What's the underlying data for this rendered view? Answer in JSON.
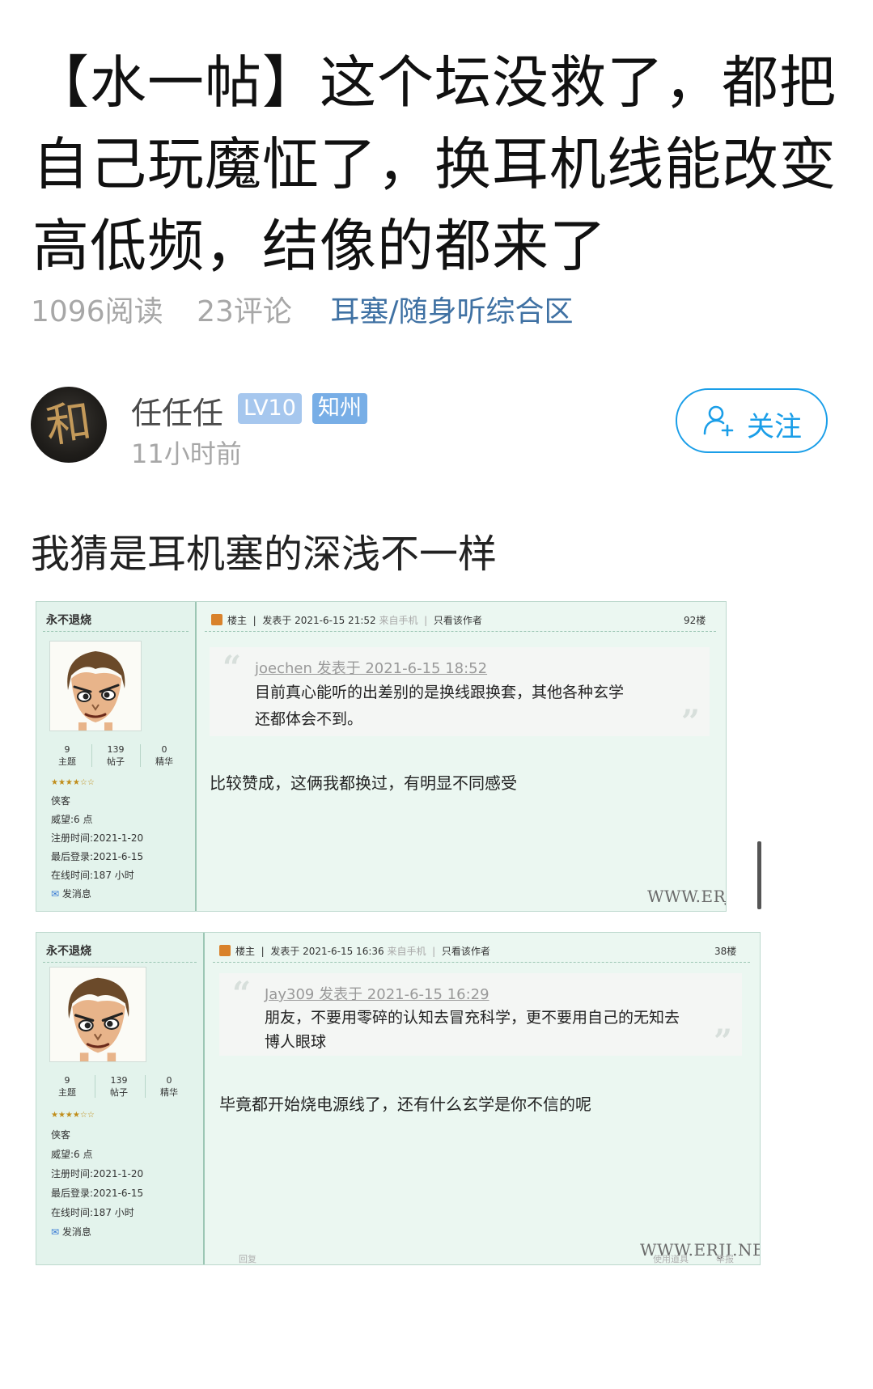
{
  "post": {
    "title": "【水一帖】这个坛没救了，都把自己玩魔怔了，换耳机线能改变高低频，结像的都来了",
    "reads": "1096阅读",
    "comments": "23评论",
    "forum": "耳塞/随身听综合区"
  },
  "author": {
    "avatar_glyph": "和",
    "name": "任任任",
    "level": "LV10",
    "location": "知州",
    "time": "11小时前",
    "follow_label": "关注"
  },
  "content": {
    "text": "我猜是耳机塞的深浅不一样"
  },
  "screenshots": [
    {
      "username": "永不退烧",
      "stats": [
        {
          "num": "9",
          "label": "主题"
        },
        {
          "num": "139",
          "label": "帖子"
        },
        {
          "num": "0",
          "label": "精华"
        }
      ],
      "stars": "★★★★☆☆",
      "rank": "侠客",
      "reputation": "威望:6 点",
      "register": "注册时间:2021-1-20",
      "last_login": "最后登录:2021-6-15",
      "online": "在线时间:187 小时",
      "message": "发消息",
      "head_owner": "楼主",
      "head_posted": "发表于 2021-6-15 21:52",
      "head_device": "来自手机",
      "head_only": "只看该作者",
      "floor": "92楼",
      "quote_source": "joechen 发表于 2021-6-15 18:52",
      "quote_line1": "目前真心能听的出差别的是换线跟换套，其他各种玄学",
      "quote_line2": "还都体会不到。",
      "reply": "比较赞成，这俩我都换过，有明显不同感受",
      "watermark": "WWW.ERJI.NET"
    },
    {
      "username": "永不退烧",
      "stats": [
        {
          "num": "9",
          "label": "主题"
        },
        {
          "num": "139",
          "label": "帖子"
        },
        {
          "num": "0",
          "label": "精华"
        }
      ],
      "stars": "★★★★☆☆",
      "rank": "侠客",
      "reputation": "威望:6 点",
      "register": "注册时间:2021-1-20",
      "last_login": "最后登录:2021-6-15",
      "online": "在线时间:187 小时",
      "message": "发消息",
      "head_owner": "楼主",
      "head_posted": "发表于 2021-6-15 16:36",
      "head_device": "来自手机",
      "head_only": "只看该作者",
      "floor": "38楼",
      "quote_source": "Jay309 发表于 2021-6-15 16:29",
      "quote_line1": "朋友，不要用零碎的认知去冒充科学，更不要用自己的无知去",
      "quote_line2": "博人眼球",
      "reply": "毕竟都开始烧电源线了，还有什么玄学是你不信的呢",
      "watermark": "WWW.ERJI.NET",
      "footer_reply": "回复",
      "footer_tools": "使用道具",
      "footer_report": "举报"
    }
  ],
  "colors": {
    "follow_blue": "#1a9ee8",
    "forum_link": "#3f71a3",
    "level_badge": "#a6c7ee",
    "location_badge": "#78aee6",
    "screenshot_bg": "#ebf7f1"
  }
}
